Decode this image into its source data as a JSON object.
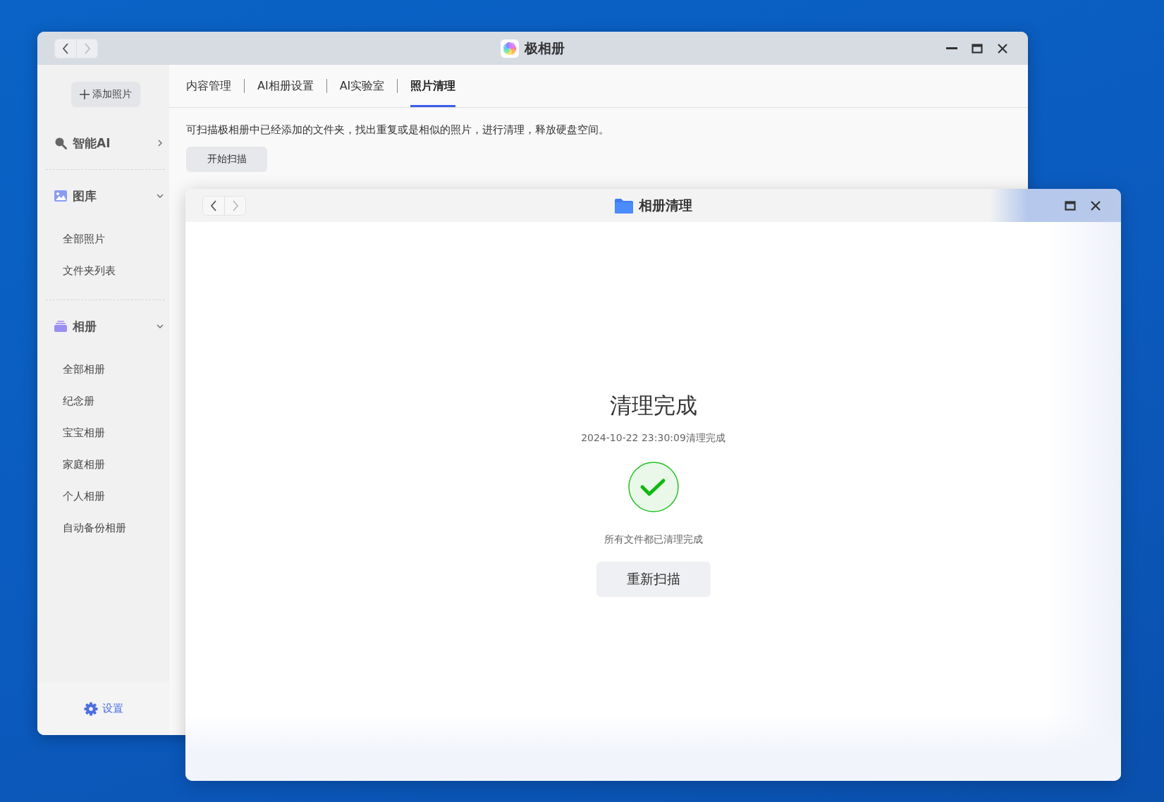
{
  "main_window": {
    "title": "极相册",
    "add_button": "添加照片",
    "sidebar": {
      "groups": [
        {
          "label": "智能AI",
          "expanded": false
        },
        {
          "label": "图库",
          "expanded": true,
          "items": [
            "全部照片",
            "文件夹列表"
          ]
        },
        {
          "label": "相册",
          "expanded": true,
          "items": [
            "全部相册",
            "纪念册",
            "宝宝相册",
            "家庭相册",
            "个人相册",
            "自动备份相册"
          ]
        }
      ],
      "settings": "设置"
    },
    "tabs": [
      {
        "label": "内容管理",
        "selected": false
      },
      {
        "label": "AI相册设置",
        "selected": false
      },
      {
        "label": "AI实验室",
        "selected": false
      },
      {
        "label": "照片清理",
        "selected": true
      }
    ],
    "description": "可扫描极相册中已经添加的文件夹，找出重复或是相似的照片，进行清理，释放硬盘空间。",
    "scan_button": "开始扫描"
  },
  "dialog": {
    "title": "相册清理",
    "heading": "清理完成",
    "timestamp": "2024-10-22 23:30:09清理完成",
    "message": "所有文件都已清理完成",
    "rescan_button": "重新扫描"
  }
}
